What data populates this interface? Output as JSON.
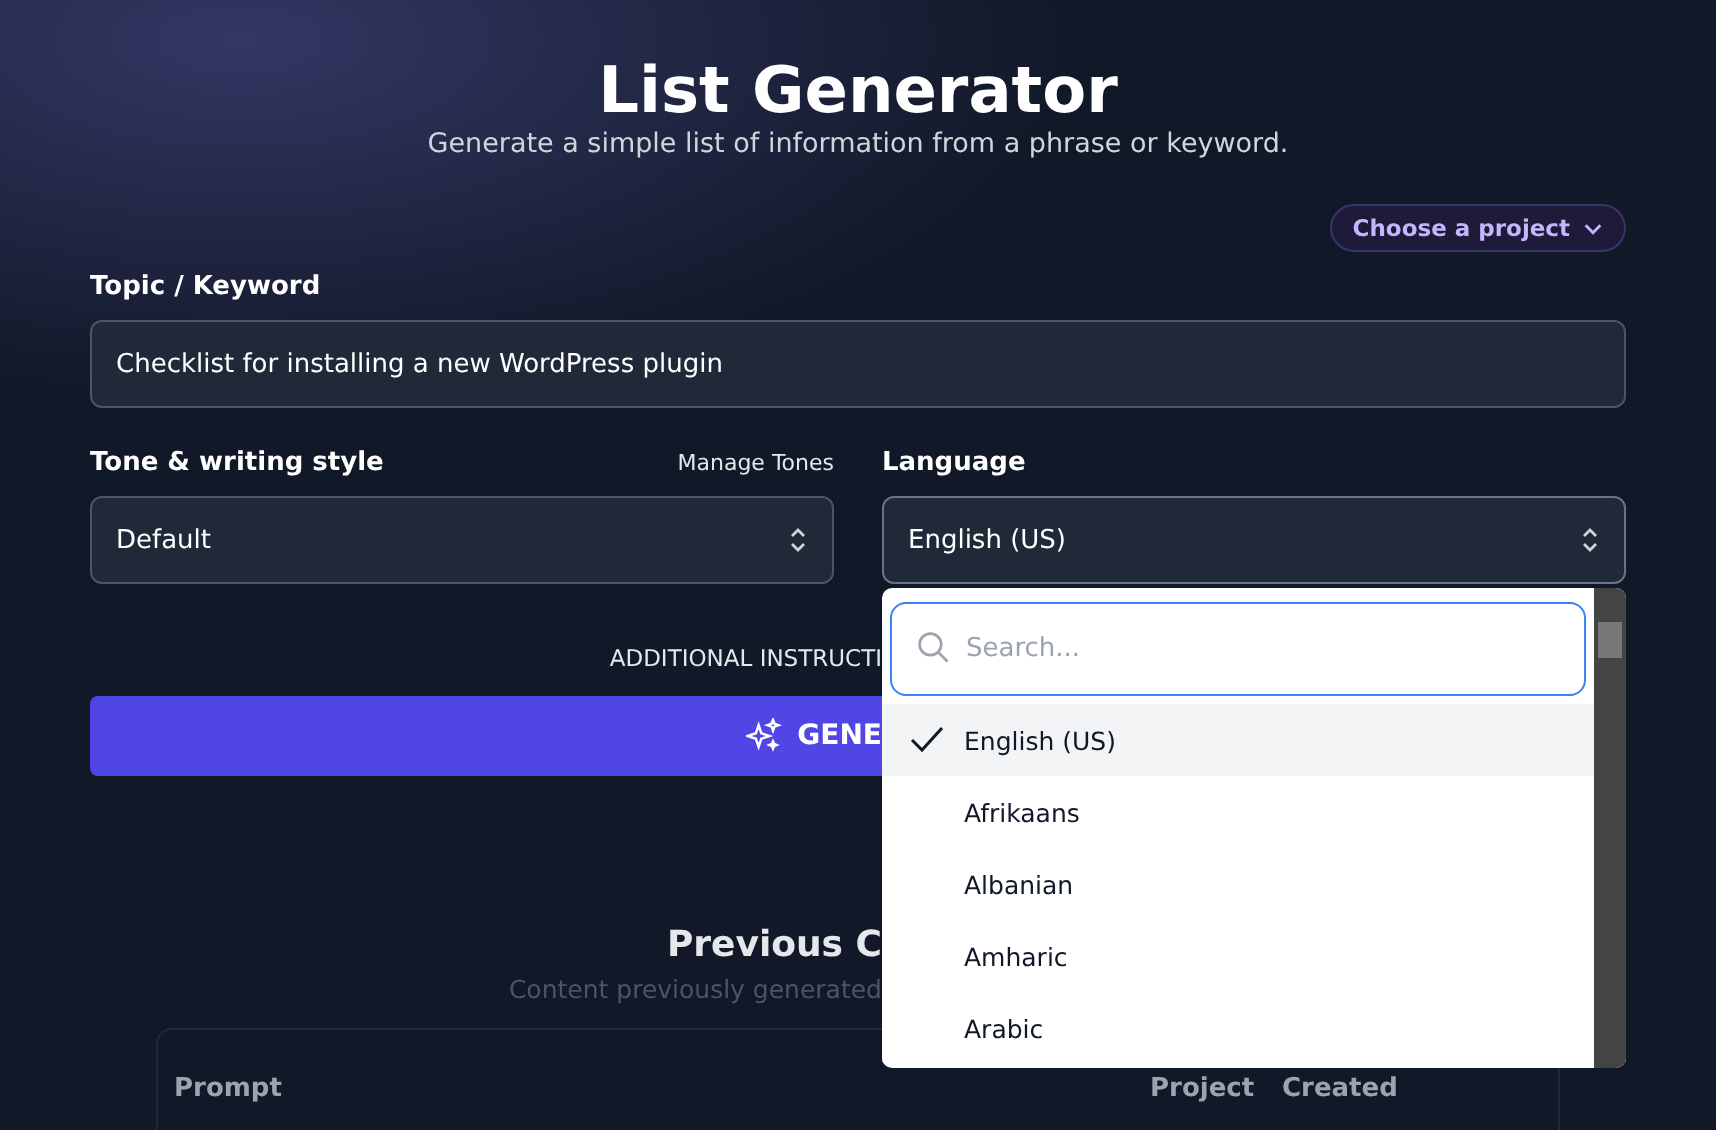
{
  "header": {
    "title": "List Generator",
    "subtitle": "Generate a simple list of information from a phrase or keyword."
  },
  "project_picker": {
    "label": "Choose a project"
  },
  "topic": {
    "label": "Topic / Keyword",
    "value": "Checklist for installing a new WordPress plugin"
  },
  "tone": {
    "label": "Tone & writing style",
    "link": "Manage Tones",
    "value": "Default"
  },
  "language": {
    "label": "Language",
    "value": "English (US)",
    "expanded": true,
    "dropdown": {
      "placeholder": "Search...",
      "options": [
        {
          "label": "English (US)",
          "selected": true
        },
        {
          "label": "Afrikaans",
          "selected": false
        },
        {
          "label": "Albanian",
          "selected": false
        },
        {
          "label": "Amharic",
          "selected": false
        },
        {
          "label": "Arabic",
          "selected": false
        }
      ]
    }
  },
  "additional_instructions": "ADDITIONAL INSTRUCTI",
  "generate_button": "GENE",
  "previous": {
    "title": "Previous C",
    "subtitle": "Content previously generated",
    "columns": [
      "Prompt",
      "Project",
      "Created"
    ]
  }
}
